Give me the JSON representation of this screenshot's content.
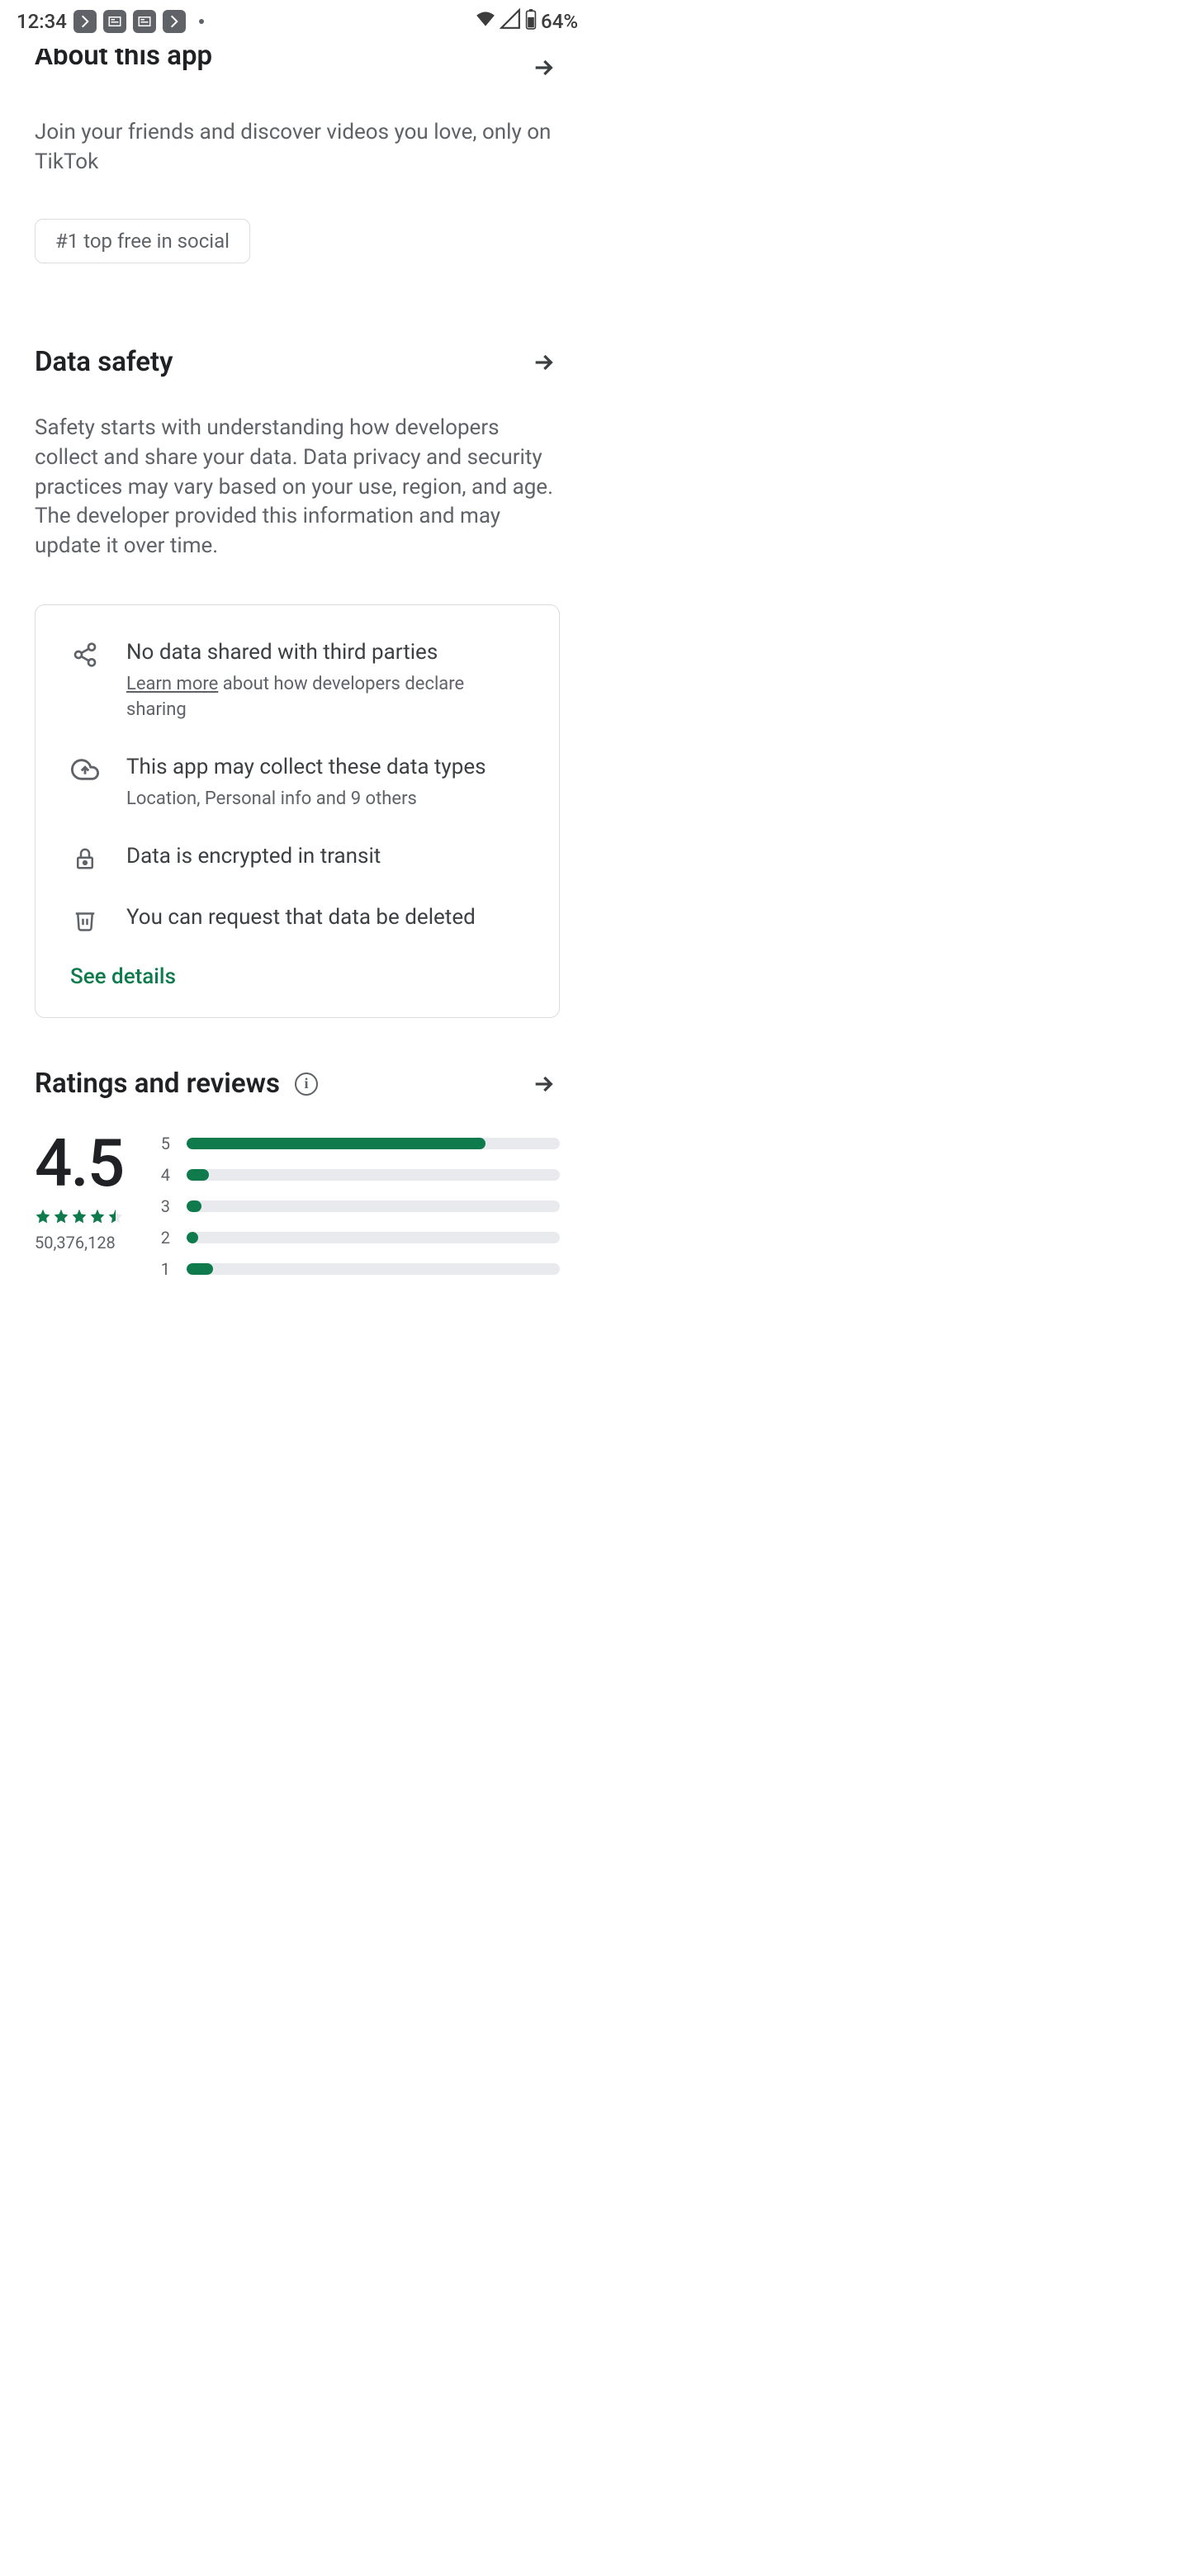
{
  "status_bar": {
    "time": "12:34",
    "battery": "64%"
  },
  "about": {
    "title": "About this app",
    "description": "Join your friends and discover videos you love, only on TikTok",
    "chip": "#1 top free in social"
  },
  "data_safety": {
    "title": "Data safety",
    "description": "Safety starts with understanding how developers collect and share your data. Data privacy and security practices may vary based on your use, region, and age. The developer provided this information and may update it over time.",
    "items": [
      {
        "main": "No data shared with third parties",
        "learn_more_text": "Learn more",
        "sub_rest": " about how developers declare sharing"
      },
      {
        "main": "This app may collect these data types",
        "sub": "Location, Personal info and 9 others"
      },
      {
        "main": "Data is encrypted in transit"
      },
      {
        "main": "You can request that data be deleted"
      }
    ],
    "see_details": "See details"
  },
  "ratings": {
    "title": "Ratings and reviews",
    "score": "4.5",
    "count": "50,376,128",
    "chart_data": {
      "type": "bar",
      "categories": [
        "5",
        "4",
        "3",
        "2",
        "1"
      ],
      "values": [
        80,
        6,
        4,
        3,
        7
      ],
      "xlabel": "",
      "ylabel": "",
      "ylim": [
        0,
        100
      ]
    }
  }
}
